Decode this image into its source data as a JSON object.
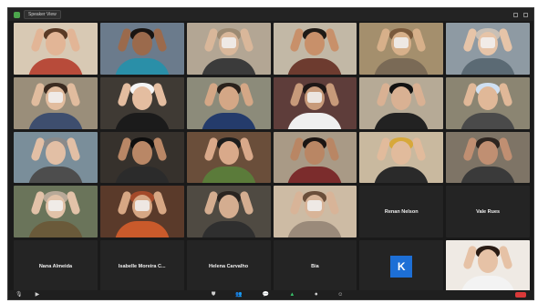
{
  "window": {
    "view_button_label": "Speaker View"
  },
  "gallery": [
    {
      "type": "video",
      "name": "",
      "bg": "#d8c9b4",
      "skin": "#e2b596",
      "hair": "#5a3a26",
      "shirt": "#b84b3a"
    },
    {
      "type": "video",
      "name": "",
      "bg": "#6b7b8c",
      "skin": "#9b6a4c",
      "hair": "#181412",
      "shirt": "#2a8fa8"
    },
    {
      "type": "video",
      "name": "",
      "bg": "#b3a694",
      "skin": "#d9b79a",
      "hair": "#9c8a72",
      "shirt": "#3b3b3b",
      "prop": true
    },
    {
      "type": "video",
      "name": "",
      "bg": "#c2b8a6",
      "skin": "#c8906a",
      "hair": "#1f1a16",
      "shirt": "#6d3b2f"
    },
    {
      "type": "video",
      "name": "",
      "bg": "#a48f6d",
      "skin": "#d7b08a",
      "hair": "#7a5a3c",
      "shirt": "#7a6a56",
      "prop": true
    },
    {
      "type": "video",
      "name": "",
      "bg": "#8e9aa3",
      "skin": "#e6c4a8",
      "hair": "#c9c0b6",
      "shirt": "#5b6a74",
      "prop": true
    },
    {
      "type": "video",
      "name": "",
      "bg": "#9a8e7a",
      "skin": "#e1bc9e",
      "hair": "#3b2b20",
      "shirt": "#3e4e6e",
      "prop": true
    },
    {
      "type": "video",
      "name": "",
      "bg": "#3f3a34",
      "skin": "#e4bda0",
      "hair": "#f4f4f4",
      "shirt": "#1b1b1b"
    },
    {
      "type": "video",
      "name": "",
      "bg": "#8c8b7a",
      "skin": "#d4a786",
      "hair": "#2a221c",
      "shirt": "#243b6b"
    },
    {
      "type": "video",
      "name": "",
      "bg": "#5e3d3a",
      "skin": "#c79a7a",
      "hair": "#1e1716",
      "shirt": "#efefef",
      "prop": true
    },
    {
      "type": "video",
      "name": "",
      "bg": "#b6aa96",
      "skin": "#d9b193",
      "hair": "#121212",
      "shirt": "#222222"
    },
    {
      "type": "video",
      "name": "",
      "bg": "#8b8572",
      "skin": "#e0b898",
      "hair": "#cfe0f2",
      "shirt": "#4a4a4a"
    },
    {
      "type": "video",
      "name": "",
      "bg": "#7a8e9a",
      "skin": "#e2bfa5",
      "hair": "#8a8a8a",
      "shirt": "#4d4d4d"
    },
    {
      "type": "video",
      "name": "",
      "bg": "#36312c",
      "skin": "#b98766",
      "hair": "#0e0e0e",
      "shirt": "#2b2b2b"
    },
    {
      "type": "video",
      "name": "",
      "bg": "#6a4e3a",
      "skin": "#d9a98a",
      "hair": "#1c1c1c",
      "shirt": "#5b7b3a"
    },
    {
      "type": "video",
      "name": "",
      "bg": "#a99a86",
      "skin": "#b98664",
      "hair": "#1b1513",
      "shirt": "#7b2c2c"
    },
    {
      "type": "video",
      "name": "",
      "bg": "#c9b99f",
      "skin": "#e1bb9c",
      "hair": "#d7a83a",
      "shirt": "#2a2a2a"
    },
    {
      "type": "video",
      "name": "",
      "bg": "#7e7466",
      "skin": "#c08f72",
      "hair": "#2d2520",
      "shirt": "#3a3a3a"
    },
    {
      "type": "video",
      "name": "",
      "bg": "#6a745a",
      "skin": "#e2c2a8",
      "hair": "#b8a998",
      "shirt": "#6a5a3a",
      "prop": true
    },
    {
      "type": "video",
      "name": "",
      "bg": "#5a3a2a",
      "skin": "#d7a784",
      "hair": "#a44a2a",
      "shirt": "#c95a2b",
      "prop": true
    },
    {
      "type": "video",
      "name": "",
      "bg": "#4f4a42",
      "skin": "#d4ad90",
      "hair": "#2a2420",
      "shirt": "#2f2f2f"
    },
    {
      "type": "video",
      "name": "",
      "bg": "#cdbba4",
      "skin": "#d8b498",
      "hair": "#6a4e3a",
      "shirt": "#9a8a7a",
      "prop": true
    },
    {
      "type": "name",
      "name": "Renan Nelson"
    },
    {
      "type": "name",
      "name": "Vale Rues"
    },
    {
      "type": "name",
      "name": "Nana Almeida"
    },
    {
      "type": "name",
      "name": "Isabelle Moreira C..."
    },
    {
      "type": "name",
      "name": "Helena Carvalho"
    },
    {
      "type": "name",
      "name": "Bia"
    },
    {
      "type": "avatar",
      "letter": "K",
      "color": "#1d6fd6"
    },
    {
      "type": "video",
      "name": "",
      "bg": "#efeae4",
      "skin": "#e6c2a6",
      "hair": "#2a1c14",
      "shirt": "#f3f3f3"
    }
  ],
  "controlbar": {
    "left": [
      {
        "icon": "mic-icon",
        "glyph": "🎙"
      },
      {
        "icon": "video-camera-icon",
        "glyph": "▶"
      }
    ],
    "center": [
      {
        "icon": "security-icon",
        "glyph": "⛊"
      },
      {
        "icon": "participants-icon",
        "glyph": "👥"
      },
      {
        "icon": "chat-icon",
        "glyph": "💬"
      },
      {
        "icon": "share-screen-icon",
        "glyph": "▲",
        "accent": "green"
      },
      {
        "icon": "record-icon",
        "glyph": "⏺"
      },
      {
        "icon": "reactions-icon",
        "glyph": "☺"
      }
    ],
    "right": [
      {
        "icon": "end-call-icon",
        "glyph": ""
      }
    ]
  }
}
